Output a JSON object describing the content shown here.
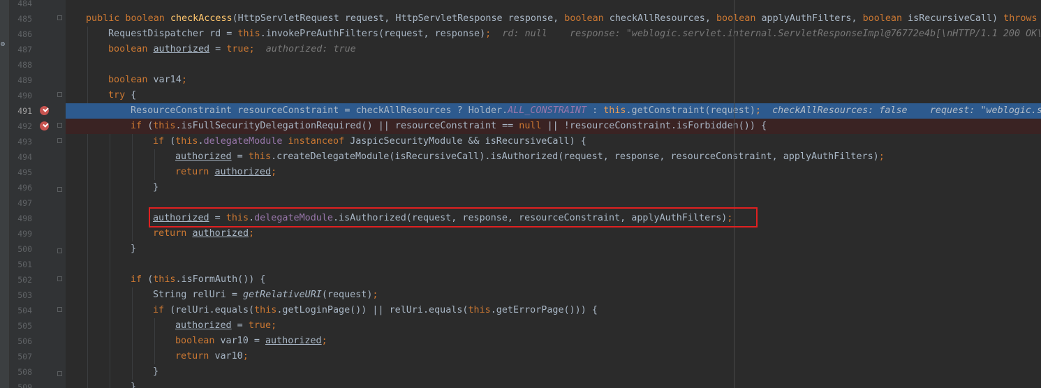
{
  "editor": {
    "current_line": "491",
    "lines": [
      {
        "num": "484",
        "indent": 0,
        "fold": "",
        "bp": false,
        "tokens": []
      },
      {
        "num": "485",
        "indent": 0,
        "fold": "open",
        "bp": false,
        "tokens": [
          {
            "t": "public boolean ",
            "c": "kw"
          },
          {
            "t": "checkAccess",
            "c": "fn"
          },
          {
            "t": "(HttpServletRequest request, HttpServletResponse response, "
          },
          {
            "t": "boolean ",
            "c": "kw"
          },
          {
            "t": "checkAllResources, "
          },
          {
            "t": "boolean ",
            "c": "kw"
          },
          {
            "t": "applyAuthFilters, "
          },
          {
            "t": "boolean ",
            "c": "kw"
          },
          {
            "t": "isRecursiveCall) "
          },
          {
            "t": "throws ",
            "c": "kw"
          },
          {
            "t": "I"
          }
        ]
      },
      {
        "num": "486",
        "indent": 1,
        "fold": "",
        "bp": false,
        "tokens": [
          {
            "t": "RequestDispatcher rd = "
          },
          {
            "t": "this",
            "c": "kw"
          },
          {
            "t": ".invokePreAuthFilters(request, response)"
          },
          {
            "t": ";",
            "c": "kw"
          },
          {
            "t": "  rd: null    response: \"weblogic.servlet.internal.ServletResponseImpl@76772e4b[\\nHTTP/1.1 200 OK\\r",
            "c": "hint"
          }
        ]
      },
      {
        "num": "487",
        "indent": 1,
        "fold": "",
        "bp": false,
        "tokens": [
          {
            "t": "boolean ",
            "c": "kw"
          },
          {
            "t": "authorized",
            "c": "und"
          },
          {
            "t": " = "
          },
          {
            "t": "true",
            "c": "kw"
          },
          {
            "t": ";",
            "c": "kw"
          },
          {
            "t": "  authorized: true",
            "c": "hint"
          }
        ]
      },
      {
        "num": "488",
        "indent": 0,
        "fold": "",
        "bp": false,
        "tokens": []
      },
      {
        "num": "489",
        "indent": 1,
        "fold": "",
        "bp": false,
        "tokens": [
          {
            "t": "boolean ",
            "c": "kw"
          },
          {
            "t": "var14"
          },
          {
            "t": ";",
            "c": "kw"
          }
        ]
      },
      {
        "num": "490",
        "indent": 1,
        "fold": "open",
        "bp": false,
        "tokens": [
          {
            "t": "try ",
            "c": "kw"
          },
          {
            "t": "{"
          }
        ]
      },
      {
        "num": "491",
        "indent": 2,
        "fold": "",
        "bp": true,
        "state": "exec",
        "tokens": [
          {
            "t": "ResourceConstraint resourceConstraint = checkAllResources ? Holder."
          },
          {
            "t": "ALL_CONSTRAINT",
            "c": "cst"
          },
          {
            "t": " : "
          },
          {
            "t": "this",
            "c": "kw"
          },
          {
            "t": ".getConstraint(request)"
          },
          {
            "t": ";",
            "c": "kw"
          },
          {
            "t": "  checkAllResources: false    request: \"weblogic.se",
            "c": "hint"
          }
        ]
      },
      {
        "num": "492",
        "indent": 2,
        "fold": "open",
        "bp": true,
        "state": "bpline",
        "tokens": [
          {
            "t": "if ",
            "c": "kw"
          },
          {
            "t": "("
          },
          {
            "t": "this",
            "c": "kw"
          },
          {
            "t": ".isFullSecurityDelegationRequired() || resourceConstraint == "
          },
          {
            "t": "null",
            "c": "kw"
          },
          {
            "t": " || !resourceConstraint.isForbidden()) {"
          }
        ]
      },
      {
        "num": "493",
        "indent": 3,
        "fold": "open",
        "bp": false,
        "tokens": [
          {
            "t": "if ",
            "c": "kw"
          },
          {
            "t": "("
          },
          {
            "t": "this",
            "c": "kw"
          },
          {
            "t": "."
          },
          {
            "t": "delegateModule",
            "c": "fld"
          },
          {
            "t": " instanceof ",
            "c": "kw"
          },
          {
            "t": "JaspicSecurityModule && isRecursiveCall) {"
          }
        ]
      },
      {
        "num": "494",
        "indent": 4,
        "fold": "",
        "bp": false,
        "tokens": [
          {
            "t": "authorized",
            "c": "und"
          },
          {
            "t": " = "
          },
          {
            "t": "this",
            "c": "kw"
          },
          {
            "t": ".createDelegateModule(isRecursiveCall).isAuthorized(request, response, resourceConstraint, applyAuthFilters)"
          },
          {
            "t": ";",
            "c": "kw"
          }
        ]
      },
      {
        "num": "495",
        "indent": 4,
        "fold": "",
        "bp": false,
        "tokens": [
          {
            "t": "return ",
            "c": "kw"
          },
          {
            "t": "authorized",
            "c": "und"
          },
          {
            "t": ";",
            "c": "kw"
          }
        ]
      },
      {
        "num": "496",
        "indent": 3,
        "fold": "close",
        "bp": false,
        "tokens": [
          {
            "t": "}"
          }
        ]
      },
      {
        "num": "497",
        "indent": 0,
        "fold": "",
        "bp": false,
        "tokens": []
      },
      {
        "num": "498",
        "indent": 3,
        "fold": "",
        "bp": false,
        "tokens": [
          {
            "t": "authorized",
            "c": "und"
          },
          {
            "t": " = "
          },
          {
            "t": "this",
            "c": "kw"
          },
          {
            "t": "."
          },
          {
            "t": "delegateModule",
            "c": "fld"
          },
          {
            "t": ".isAuthorized(request, response, resourceConstraint, applyAuthFilters)"
          },
          {
            "t": ";",
            "c": "kw"
          }
        ]
      },
      {
        "num": "499",
        "indent": 3,
        "fold": "",
        "bp": false,
        "tokens": [
          {
            "t": "return ",
            "c": "kw"
          },
          {
            "t": "authorized",
            "c": "und"
          },
          {
            "t": ";",
            "c": "kw"
          }
        ]
      },
      {
        "num": "500",
        "indent": 2,
        "fold": "close",
        "bp": false,
        "tokens": [
          {
            "t": "}"
          }
        ]
      },
      {
        "num": "501",
        "indent": 0,
        "fold": "",
        "bp": false,
        "tokens": []
      },
      {
        "num": "502",
        "indent": 2,
        "fold": "open",
        "bp": false,
        "tokens": [
          {
            "t": "if ",
            "c": "kw"
          },
          {
            "t": "("
          },
          {
            "t": "this",
            "c": "kw"
          },
          {
            "t": ".isFormAuth()) {"
          }
        ]
      },
      {
        "num": "503",
        "indent": 3,
        "fold": "",
        "bp": false,
        "tokens": [
          {
            "t": "String relUri = "
          },
          {
            "t": "getRelativeURI",
            "c": "sm"
          },
          {
            "t": "(request)"
          },
          {
            "t": ";",
            "c": "kw"
          }
        ]
      },
      {
        "num": "504",
        "indent": 3,
        "fold": "open",
        "bp": false,
        "tokens": [
          {
            "t": "if ",
            "c": "kw"
          },
          {
            "t": "(relUri.equals("
          },
          {
            "t": "this",
            "c": "kw"
          },
          {
            "t": ".getLoginPage()) || relUri.equals("
          },
          {
            "t": "this",
            "c": "kw"
          },
          {
            "t": ".getErrorPage())) {"
          }
        ]
      },
      {
        "num": "505",
        "indent": 4,
        "fold": "",
        "bp": false,
        "tokens": [
          {
            "t": "authorized",
            "c": "und"
          },
          {
            "t": " = "
          },
          {
            "t": "true",
            "c": "kw"
          },
          {
            "t": ";",
            "c": "kw"
          }
        ]
      },
      {
        "num": "506",
        "indent": 4,
        "fold": "",
        "bp": false,
        "tokens": [
          {
            "t": "boolean ",
            "c": "kw"
          },
          {
            "t": "var10 = "
          },
          {
            "t": "authorized",
            "c": "und"
          },
          {
            "t": ";",
            "c": "kw"
          }
        ]
      },
      {
        "num": "507",
        "indent": 4,
        "fold": "",
        "bp": false,
        "tokens": [
          {
            "t": "return ",
            "c": "kw"
          },
          {
            "t": "var10"
          },
          {
            "t": ";",
            "c": "kw"
          }
        ]
      },
      {
        "num": "508",
        "indent": 3,
        "fold": "close",
        "bp": false,
        "tokens": [
          {
            "t": "}"
          }
        ]
      },
      {
        "num": "509",
        "indent": 2,
        "fold": "",
        "bp": false,
        "tokens": [
          {
            "t": "}"
          }
        ]
      }
    ]
  }
}
